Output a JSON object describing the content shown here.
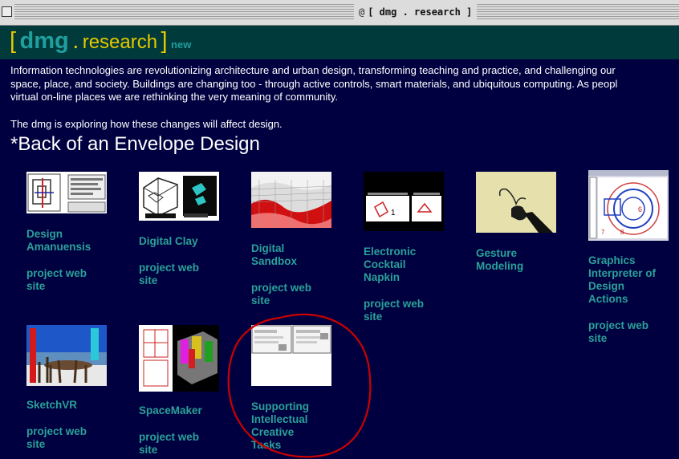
{
  "window": {
    "title": "[ dmg . research ]"
  },
  "header": {
    "bracket_open": "[",
    "dmg": "dmg",
    "dot": ".",
    "research": "research",
    "bracket_close": "]",
    "new_link": "new"
  },
  "intro": {
    "p1_line1": "Information technologies are revolutionizing architecture and urban design, transforming teaching and practice, and challenging our",
    "p1_line2": "space, place, and society. Buildings are changing too - through active controls, smart materials, and ubiquitous computing. As peopl",
    "p1_line3": "virtual on-line places we are rethinking the very meaning of community.",
    "p2": "The dmg is exploring how these changes will affect design."
  },
  "section": {
    "heading": "*Back of an Envelope Design"
  },
  "projects": [
    {
      "title_lines": [
        "Design",
        "Amanuensis"
      ],
      "link_lines": [
        "project web",
        "site"
      ]
    },
    {
      "title_lines": [
        "Digital Clay"
      ],
      "link_lines": [
        "project web",
        "site"
      ]
    },
    {
      "title_lines": [
        "Digital",
        "Sandbox"
      ],
      "link_lines": [
        "project web",
        "site"
      ]
    },
    {
      "title_lines": [
        "Electronic",
        "Cocktail",
        "Napkin"
      ],
      "link_lines": [
        "project web",
        "site"
      ]
    },
    {
      "title_lines": [
        "Gesture",
        "Modeling"
      ]
    },
    {
      "title_lines": [
        "Graphics",
        "Interpreter of",
        "Design",
        "Actions"
      ],
      "link_lines": [
        "project web",
        "site"
      ]
    },
    {
      "title_lines": [
        "SketchVR"
      ],
      "link_lines": [
        "project web",
        "site"
      ]
    },
    {
      "title_lines": [
        "SpaceMaker"
      ],
      "link_lines": [
        "project web",
        "site"
      ]
    },
    {
      "title_lines": [
        "Supporting",
        "Intellectual",
        "Creative",
        "Tasks"
      ]
    }
  ],
  "colors": {
    "background": "#000040",
    "header_band": "#003a3a",
    "accent_yellow": "#e8c800",
    "teal": "#2aa198",
    "annotation_red": "#cc0000"
  }
}
